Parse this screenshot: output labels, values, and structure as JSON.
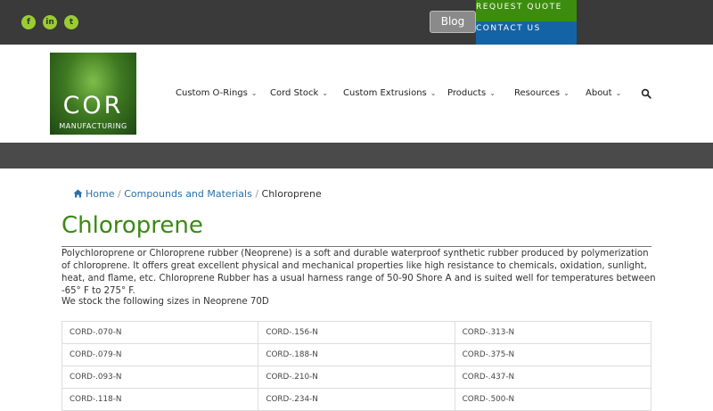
{
  "topbar": {
    "social": [
      {
        "name": "facebook-icon",
        "glyph": "f"
      },
      {
        "name": "linkedin-icon",
        "glyph": "in"
      },
      {
        "name": "twitter-icon",
        "glyph": "t"
      }
    ],
    "blog_label": "Blog",
    "request_quote_label": "REQUEST QUOTE",
    "contact_us_label": "CONTACT US"
  },
  "logo": {
    "text": "COR",
    "subtext": "MANUFACTURING"
  },
  "nav": {
    "items": [
      {
        "label": "Custom O-Rings"
      },
      {
        "label": "Cord Stock"
      },
      {
        "label": "Custom Extrusions"
      },
      {
        "label": "Products"
      },
      {
        "label": "Resources"
      },
      {
        "label": "About"
      }
    ]
  },
  "breadcrumb": {
    "home": "Home",
    "parent": "Compounds and Materials",
    "current": "Chloroprene",
    "separator": "/"
  },
  "page": {
    "title": "Chloroprene",
    "intro": "Polychloroprene or Chloroprene rubber (Neoprene) is a soft and durable waterproof synthetic rubber produced by polymerization of chloroprene. It offers great excellent physical and mechanical properties like high resistance to chemicals, oxidation, sunlight, heat, and flame, etc. Chloroprene Rubber has a usual harness range of 50-90 Shore A and is suited well for temperatures between -65° F to 275° F.",
    "stock_heading": "We stock the following sizes in Neoprene 70D"
  },
  "sizes_table": {
    "rows": [
      [
        "CORD-.070-N",
        "CORD-.156-N",
        "CORD-.313-N"
      ],
      [
        "CORD-.079-N",
        "CORD-.188-N",
        "CORD-.375-N"
      ],
      [
        "CORD-.093-N",
        "CORD-.210-N",
        "CORD-.437-N"
      ],
      [
        "CORD-.118-N",
        "CORD-.234-N",
        "CORD-.500-N"
      ]
    ]
  },
  "colors": {
    "topbar": "#3a3a3a",
    "social_icon": "#9acd32",
    "quote_green": "#3c8d0d",
    "contact_blue": "#1464a5",
    "title_green": "#3a8a12",
    "link_blue": "#2a6fa8"
  }
}
